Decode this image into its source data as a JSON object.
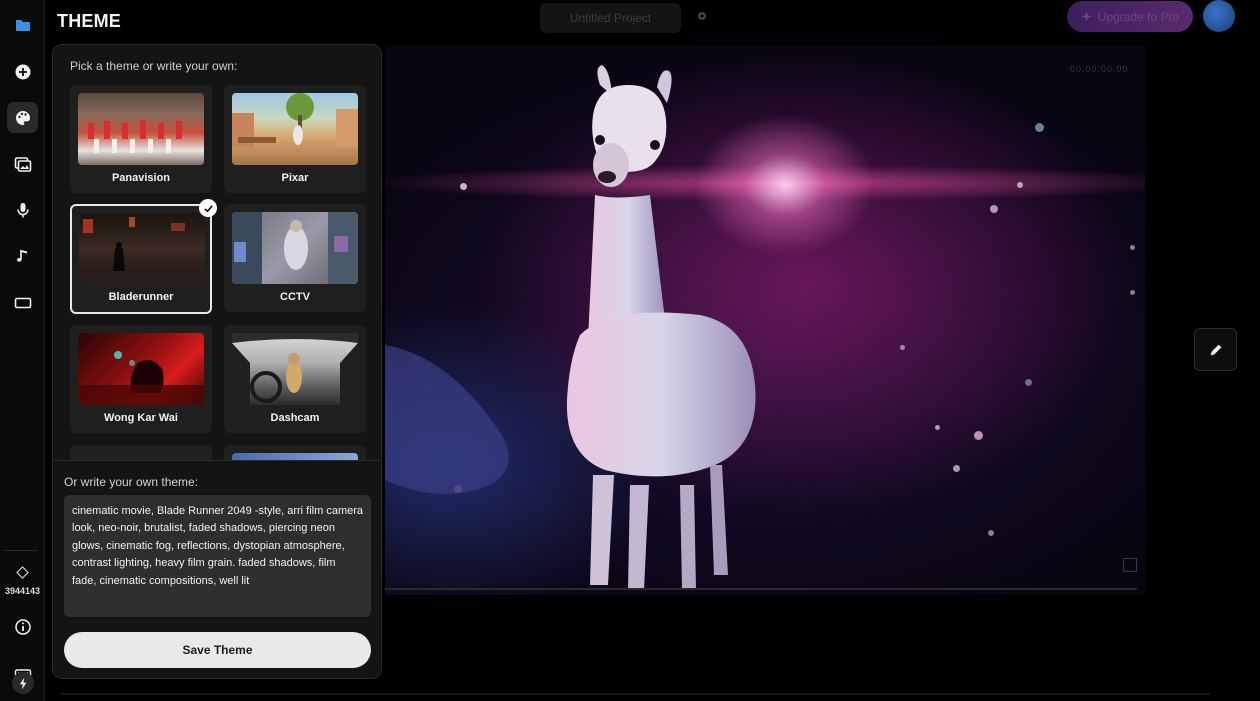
{
  "page_title": "THEME",
  "topbar": {
    "project_name": "Untitled Project",
    "upgrade_label": "Upgrade to Pro"
  },
  "sidebar": {
    "items": [
      {
        "icon": "folder-icon",
        "active": false
      },
      {
        "icon": "plus-circle-icon",
        "active": false
      },
      {
        "icon": "palette-icon",
        "active": true
      },
      {
        "icon": "images-icon",
        "active": false
      },
      {
        "icon": "microphone-icon",
        "active": false
      },
      {
        "icon": "music-note-icon",
        "active": false
      },
      {
        "icon": "aspect-ratio-icon",
        "active": false
      }
    ],
    "credits": "3944143"
  },
  "theme_panel": {
    "prompt": "Pick a theme or write your own:",
    "themes": [
      {
        "name": "Panavision",
        "selected": false
      },
      {
        "name": "Pixar",
        "selected": false
      },
      {
        "name": "Bladerunner",
        "selected": true
      },
      {
        "name": "CCTV",
        "selected": false
      },
      {
        "name": "Wong Kar Wai",
        "selected": false
      },
      {
        "name": "Dashcam",
        "selected": false
      }
    ],
    "own_label": "Or write your own theme:",
    "own_text": "cinematic movie, Blade Runner 2049 -style, arri film camera look, neo-noir, brutalist, faded shadows, piercing neon glows, cinematic fog, reflections, dystopian atmosphere, contrast lighting, heavy film grain. faded shadows, film fade, cinematic compositions, well lit",
    "save_label": "Save Theme"
  },
  "preview": {
    "timecode": "00:00:00:00"
  },
  "colors": {
    "panel_bg": "#141414",
    "accent_upgrade": "#5a2a6e",
    "save_button": "#e9e9e9"
  }
}
